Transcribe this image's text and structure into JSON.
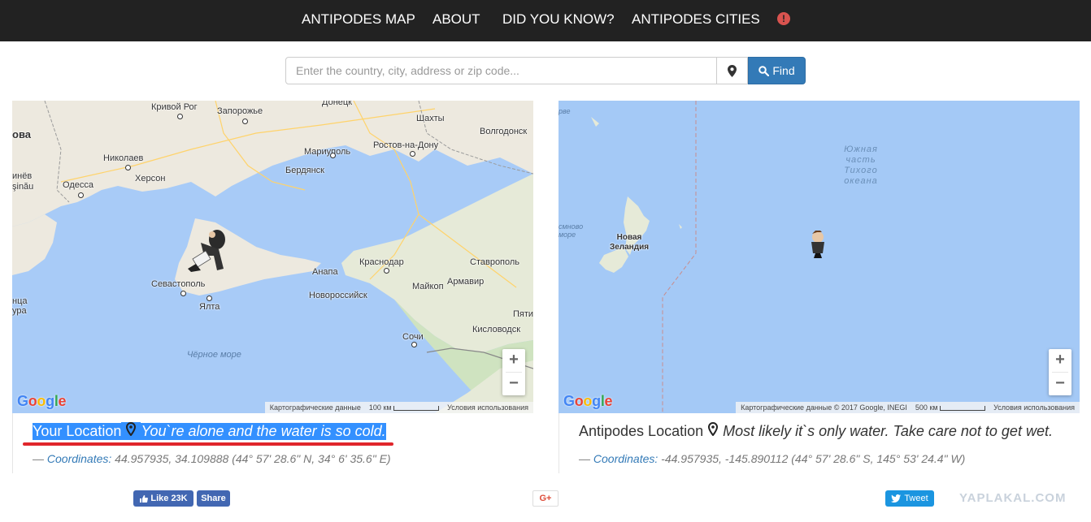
{
  "nav": {
    "items": [
      "ANTIPODES MAP",
      "ABOUT",
      "DID YOU KNOW?",
      "ANTIPODES CITIES"
    ],
    "alert_glyph": "!"
  },
  "search": {
    "placeholder": "Enter the country, city, address or zip code...",
    "find_label": "Find"
  },
  "left_map": {
    "labels": [
      "Кривой Рог",
      "Запорожье",
      "Донецк",
      "Шахты",
      "Волгодонск",
      "ова",
      "Николаев",
      "Мариуполь",
      "Ростов-на-Дону",
      "Херсон",
      "Бердянск",
      "инёв",
      "şinău",
      "Одесса",
      "Краснодар",
      "Ставрополь",
      "Анапа",
      "Севастополь",
      "Майкоп",
      "Армавир",
      "Новороссийск",
      "нца",
      "ура",
      "Ялта",
      "Пяти",
      "Кисловодск",
      "Сочи",
      "Чёрное море"
    ],
    "zoom_in": "+",
    "zoom_out": "−",
    "google": "Google",
    "attribution": "Картографические данные",
    "scale": "100 км",
    "terms": "Условия использования"
  },
  "right_map": {
    "labels": [
      "рве",
      "Южная часть Тихого океана",
      "Новая Зеландия",
      "смново море"
    ],
    "zoom_in": "+",
    "zoom_out": "−",
    "google": "Google",
    "attribution": "Картографические данные © 2017 Google, INEGI",
    "scale": "500 км",
    "terms": "Условия использования"
  },
  "your_location": {
    "title": "Your Location",
    "message": "You`re alone and the water is so cold.",
    "coords_prefix": "— ",
    "coords_label": "Coordinates:",
    "coords_value": "44.957935, 34.109888 (44° 57' 28.6\" N, 34° 6' 35.6\" E)"
  },
  "antipodes_location": {
    "title": "Antipodes Location",
    "message": "Most likely it`s only water. Take care not to get wet.",
    "coords_prefix": "— ",
    "coords_label": "Coordinates:",
    "coords_value": "-44.957935, -145.890112 (44° 57' 28.6\" S, 145° 53' 24.4\" W)"
  },
  "social": {
    "like": "Like 23K",
    "share": "Share",
    "gplus": "G+",
    "tweet": "Tweet"
  },
  "watermark": "YAPLAKAL.COM",
  "colors": {
    "nav_bg": "#222222",
    "find_btn": "#337ab7",
    "sea": "#a8cbf7",
    "land": "#eae6dc",
    "highlight": "#e0262b",
    "selection": "#3390ff"
  }
}
